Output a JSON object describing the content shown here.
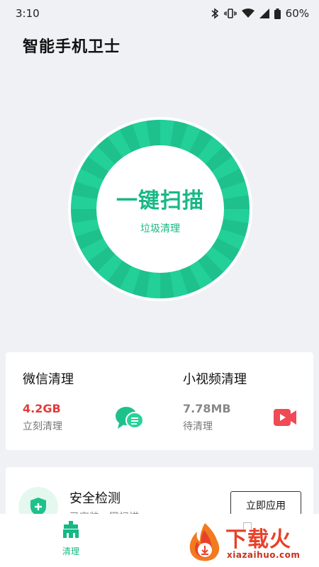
{
  "status_bar": {
    "time": "3:10",
    "battery": "60%",
    "icons": [
      "bluetooth-icon",
      "vibrate-icon",
      "wifi-icon",
      "signal-icon",
      "battery-icon"
    ]
  },
  "app": {
    "title": "智能手机卫士"
  },
  "scan": {
    "title": "一键扫描",
    "subtitle": "垃圾清理",
    "ring_color": "#22d098",
    "text_color": "#17b884"
  },
  "clean": {
    "wechat": {
      "title": "微信清理",
      "size": "4.2GB",
      "note": "立刻清理",
      "size_color": "#e23c3c",
      "icon": "wechat-chat-icon"
    },
    "short_video": {
      "title": "小视频清理",
      "size": "7.78MB",
      "note": "待清理",
      "icon": "video-camera-icon"
    }
  },
  "security": {
    "title": "安全检测",
    "subtitle": "已安装一键扫描",
    "button": "立即应用",
    "icon": "shield-plus-icon"
  },
  "nav": {
    "items": [
      {
        "label": "清理",
        "icon": "broom-icon",
        "active": true
      }
    ]
  },
  "watermark": {
    "brand": "下载火",
    "url": "xiazaihuo.com"
  }
}
